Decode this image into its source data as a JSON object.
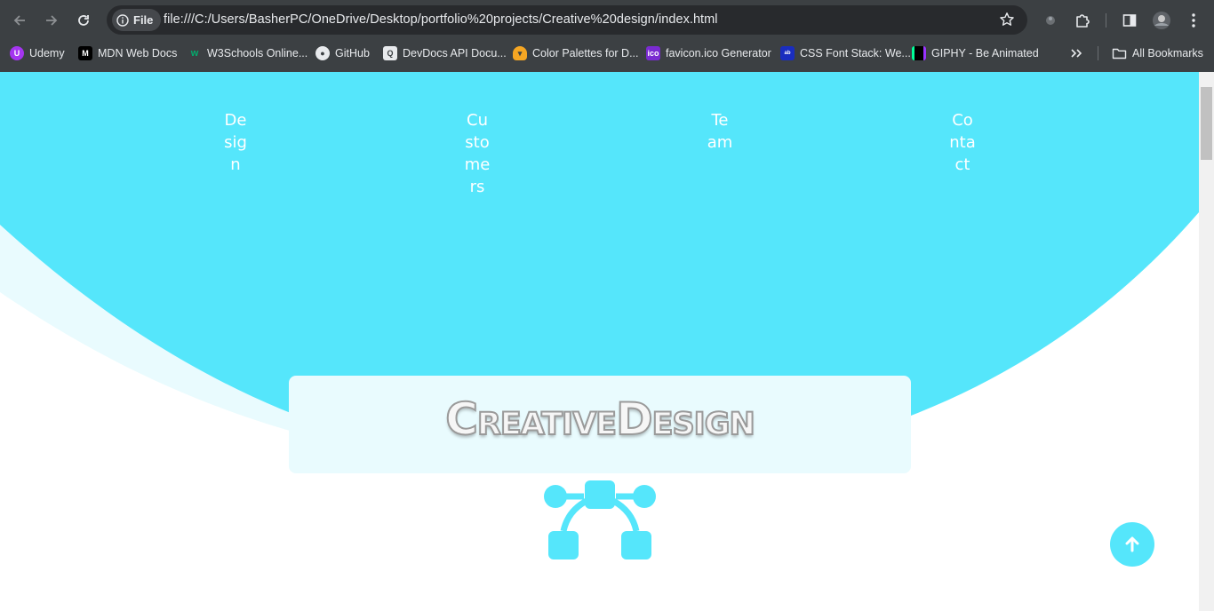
{
  "browser": {
    "site_chip": "File",
    "url": "file:///C:/Users/BasherPC/OneDrive/Desktop/portfolio%20projects/Creative%20design/index.html",
    "bookmarks": [
      {
        "label": "Udemy",
        "icon": "udemy-icon"
      },
      {
        "label": "MDN Web Docs",
        "icon": "mdn-icon"
      },
      {
        "label": "W3Schools Online...",
        "icon": "w3schools-icon"
      },
      {
        "label": "GitHub",
        "icon": "github-icon"
      },
      {
        "label": "DevDocs API Docu...",
        "icon": "devdocs-icon"
      },
      {
        "label": "Color Palettes for D...",
        "icon": "color-palette-icon"
      },
      {
        "label": "favicon.ico Generator",
        "icon": "favicon-generator-icon"
      },
      {
        "label": "CSS Font Stack: We...",
        "icon": "css-font-stack-icon"
      },
      {
        "label": "GIPHY - Be Animated",
        "icon": "giphy-icon"
      }
    ],
    "all_bookmarks": "All Bookmarks"
  },
  "page": {
    "nav": [
      "Design",
      "Customers",
      "Team",
      "Contact"
    ],
    "title": "CreativeDesign",
    "colors": {
      "accent": "#55e6fb",
      "light_wave": "#e9fbfe",
      "title_fill": "#f6f6f6"
    }
  }
}
